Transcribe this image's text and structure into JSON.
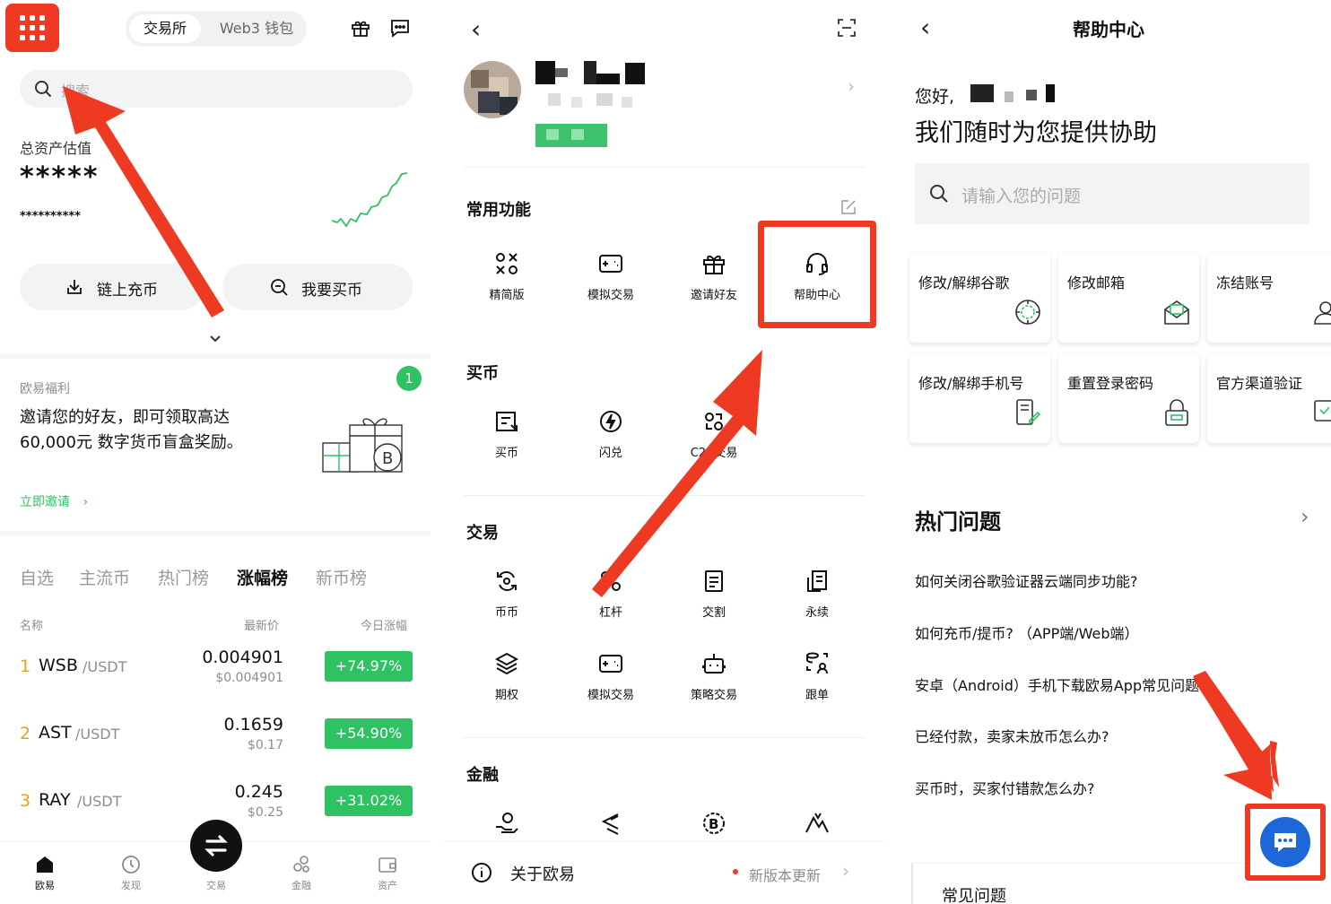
{
  "colors": {
    "accent_red": "#ee3a22",
    "green": "#2ec262",
    "blue": "#1e67d8",
    "grey_bg": "#f2f3f4"
  },
  "p1": {
    "tabs": [
      "交易所",
      "Web3 钱包"
    ],
    "search_placeholder": "搜索",
    "assets_label": "总资产估值",
    "assets_value": "*****",
    "assets_sub": "**********",
    "deposit_label": "链上充币",
    "buy_label": "我要买币",
    "promo": {
      "label": "欧易福利",
      "line1": "邀请您的好友，即可领取高达",
      "line2": "60,000元 数字货币盲盒奖励。",
      "link": "立即邀请",
      "badge": "1"
    },
    "market_tabs": [
      "自选",
      "主流币",
      "热门榜",
      "涨幅榜",
      "新币榜"
    ],
    "col_name": "名称",
    "col_price": "最新价",
    "col_change": "今日涨幅",
    "rows": [
      {
        "rank": "1",
        "coin": "WSB",
        "quote": "/USDT",
        "price": "0.004901",
        "fiat": "$0.004901",
        "change": "+74.97%"
      },
      {
        "rank": "2",
        "coin": "AST",
        "quote": "/USDT",
        "price": "0.1659",
        "fiat": "$0.17",
        "change": "+54.90%"
      },
      {
        "rank": "3",
        "coin": "RAY",
        "quote": "/USDT",
        "price": "0.245",
        "fiat": "$0.25",
        "change": "+31.02%"
      }
    ],
    "nav": [
      "欧易",
      "发现",
      "交易",
      "金融",
      "资产"
    ]
  },
  "p2": {
    "section_common": "常用功能",
    "common": [
      "精简版",
      "模拟交易",
      "邀请好友",
      "帮助中心"
    ],
    "section_buy": "买币",
    "buy": [
      "买币",
      "闪兑",
      "C2C交易"
    ],
    "section_trade": "交易",
    "trade_row1": [
      "币币",
      "杠杆",
      "交割",
      "永续"
    ],
    "trade_row2": [
      "期权",
      "模拟交易",
      "策略交易",
      "跟单"
    ],
    "section_finance": "金融",
    "about": "关于欧易",
    "update": "新版本更新"
  },
  "p3": {
    "title": "帮助中心",
    "greet": "您好,",
    "headline": "我们随时为您提供协助",
    "search_placeholder": "请输入您的问题",
    "cards": [
      "修改/解绑谷歌",
      "修改邮箱",
      "冻结账号",
      "修改/解绑手机号",
      "重置登录密码",
      "官方渠道验证"
    ],
    "hot_title": "热门问题",
    "questions": [
      "如何关闭谷歌验证器云端同步功能?",
      "如何充币/提币? （APP端/Web端）",
      "安卓（Android）手机下载欧易App常见问题",
      "已经付款，卖家未放币怎么办?",
      "买币时，买家付错款怎么办?"
    ],
    "faq_label": "常见问题"
  }
}
